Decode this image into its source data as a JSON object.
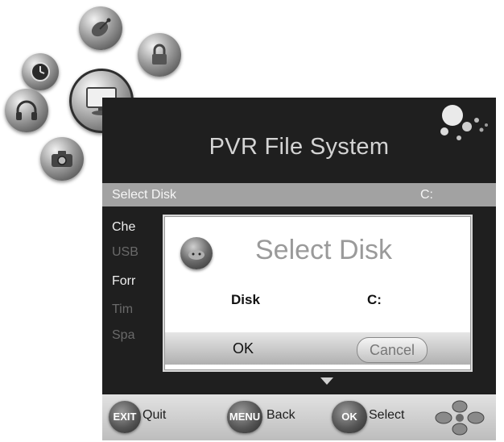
{
  "panel": {
    "title": "PVR File System"
  },
  "menu": {
    "items": [
      {
        "label": "Select Disk",
        "value": "C:"
      },
      {
        "label": "Che",
        "value": ""
      },
      {
        "label": "USB",
        "value": ""
      },
      {
        "label": "Forr",
        "value": ""
      },
      {
        "label": "Tim",
        "value": ""
      },
      {
        "label": "Spa",
        "value": ""
      }
    ]
  },
  "dialog": {
    "title": "Select Disk",
    "field_label": "Disk",
    "field_value": "C:",
    "ok_label": "OK",
    "cancel_label": "Cancel"
  },
  "bottom_bar": {
    "exit_key": "EXIT",
    "exit_label": "Quit",
    "menu_key": "MENU",
    "menu_label": "Back",
    "ok_key": "OK",
    "ok_label": "Select"
  },
  "icons": {
    "orbs": [
      "clock-icon",
      "satellite-icon",
      "lock-icon",
      "headphones-icon",
      "monitor-icon",
      "camera-icon"
    ],
    "dialog_icon": "disk-icon",
    "dpad": "navigation-pad-icon"
  },
  "colors": {
    "panel_bg": "#1f1f1f",
    "selected_row": "#a2a2a2",
    "dim_text": "#6a6a6a",
    "dialog_bg": "#ffffff"
  }
}
